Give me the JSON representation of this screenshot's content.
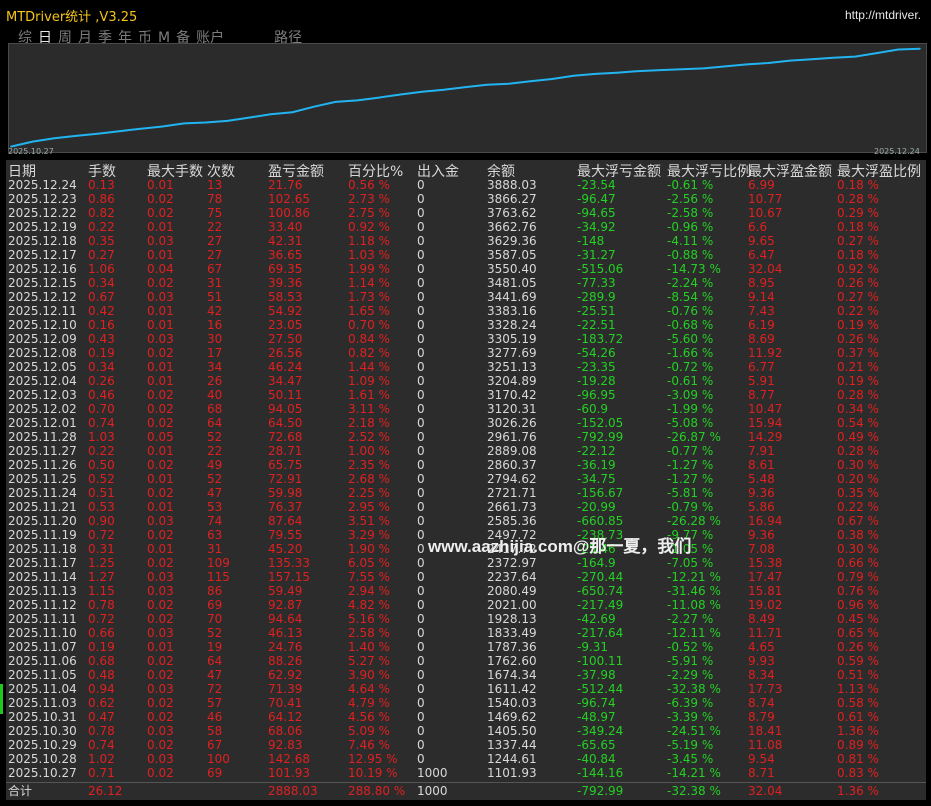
{
  "window": {
    "title": "MTDriver统计 ,V3.25",
    "url": "http://mtdriver."
  },
  "tabs": [
    {
      "label": "综",
      "active": false
    },
    {
      "label": "日",
      "active": true
    },
    {
      "label": "周",
      "active": false
    },
    {
      "label": "月",
      "active": false
    },
    {
      "label": "季",
      "active": false
    },
    {
      "label": "年",
      "active": false
    },
    {
      "label": "币",
      "active": false
    },
    {
      "label": "M",
      "active": false
    },
    {
      "label": "备",
      "active": false
    },
    {
      "label": "账户",
      "active": false
    }
  ],
  "route_tab": "路径",
  "chart": {
    "start_label": "2025.10.27",
    "end_label": "2025.12.24",
    "line_color": "#22b4f0",
    "type": "line"
  },
  "chart_data": {
    "type": "line",
    "x_start": "2025.10.27",
    "x_end": "2025.12.24",
    "x": [
      "2025.10.27",
      "2025.10.28",
      "2025.10.29",
      "2025.10.30",
      "2025.10.31",
      "2025.11.03",
      "2025.11.04",
      "2025.11.05",
      "2025.11.06",
      "2025.11.07",
      "2025.11.10",
      "2025.11.11",
      "2025.11.12",
      "2025.11.13",
      "2025.11.14",
      "2025.11.17",
      "2025.11.18",
      "2025.11.19",
      "2025.11.20",
      "2025.11.21",
      "2025.11.24",
      "2025.11.25",
      "2025.11.26",
      "2025.11.27",
      "2025.11.28",
      "2025.12.01",
      "2025.12.02",
      "2025.12.03",
      "2025.12.04",
      "2025.12.05",
      "2025.12.08",
      "2025.12.09",
      "2025.12.10",
      "2025.12.11",
      "2025.12.12",
      "2025.12.15",
      "2025.12.16",
      "2025.12.17",
      "2025.12.18",
      "2025.12.19",
      "2025.12.22",
      "2025.12.23",
      "2025.12.24"
    ],
    "series": [
      {
        "values": [
          1101.93,
          1244.61,
          1337.44,
          1405.5,
          1469.62,
          1540.03,
          1611.42,
          1674.34,
          1762.6,
          1787.36,
          1833.49,
          1928.13,
          2021.0,
          2080.49,
          2237.64,
          2372.97,
          2417.72,
          2497.72,
          2585.36,
          2661.73,
          2721.71,
          2794.62,
          2860.37,
          2889.08,
          2961.76,
          3026.26,
          3120.31,
          3170.42,
          3204.89,
          3251.13,
          3277.69,
          3305.19,
          3328.24,
          3383.16,
          3441.69,
          3481.05,
          3550.4,
          3587.05,
          3629.36,
          3662.76,
          3763.62,
          3866.27,
          3888.03
        ]
      }
    ]
  },
  "table": {
    "headers": [
      "日期",
      "手数",
      "最大手数",
      "次数",
      "盈亏金额",
      "百分比%",
      "出入金",
      "余额",
      "最大浮亏金额",
      "最大浮亏比例",
      "最大浮盈金额",
      "最大浮盈比例"
    ],
    "rows": [
      [
        "2025.12.24",
        "0.13",
        "0.01",
        "13",
        "21.76",
        "0.56 %",
        "0",
        "3888.03",
        "-23.54",
        "-0.61 %",
        "6.99",
        "0.18 %"
      ],
      [
        "2025.12.23",
        "0.86",
        "0.02",
        "78",
        "102.65",
        "2.73 %",
        "0",
        "3866.27",
        "-96.47",
        "-2.56 %",
        "10.77",
        "0.28 %"
      ],
      [
        "2025.12.22",
        "0.82",
        "0.02",
        "75",
        "100.86",
        "2.75 %",
        "0",
        "3763.62",
        "-94.65",
        "-2.58 %",
        "10.67",
        "0.29 %"
      ],
      [
        "2025.12.19",
        "0.22",
        "0.01",
        "22",
        "33.40",
        "0.92 %",
        "0",
        "3662.76",
        "-34.92",
        "-0.96 %",
        "6.6",
        "0.18 %"
      ],
      [
        "2025.12.18",
        "0.35",
        "0.03",
        "27",
        "42.31",
        "1.18 %",
        "0",
        "3629.36",
        "-148",
        "-4.11 %",
        "9.65",
        "0.27 %"
      ],
      [
        "2025.12.17",
        "0.27",
        "0.01",
        "27",
        "36.65",
        "1.03 %",
        "0",
        "3587.05",
        "-31.27",
        "-0.88 %",
        "6.47",
        "0.18 %"
      ],
      [
        "2025.12.16",
        "1.06",
        "0.04",
        "67",
        "69.35",
        "1.99 %",
        "0",
        "3550.40",
        "-515.06",
        "-14.73 %",
        "32.04",
        "0.92 %"
      ],
      [
        "2025.12.15",
        "0.34",
        "0.02",
        "31",
        "39.36",
        "1.14 %",
        "0",
        "3481.05",
        "-77.33",
        "-2.24 %",
        "8.95",
        "0.26 %"
      ],
      [
        "2025.12.12",
        "0.67",
        "0.03",
        "51",
        "58.53",
        "1.73 %",
        "0",
        "3441.69",
        "-289.9",
        "-8.54 %",
        "9.14",
        "0.27 %"
      ],
      [
        "2025.12.11",
        "0.42",
        "0.01",
        "42",
        "54.92",
        "1.65 %",
        "0",
        "3383.16",
        "-25.51",
        "-0.76 %",
        "7.43",
        "0.22 %"
      ],
      [
        "2025.12.10",
        "0.16",
        "0.01",
        "16",
        "23.05",
        "0.70 %",
        "0",
        "3328.24",
        "-22.51",
        "-0.68 %",
        "6.19",
        "0.19 %"
      ],
      [
        "2025.12.09",
        "0.43",
        "0.03",
        "30",
        "27.50",
        "0.84 %",
        "0",
        "3305.19",
        "-183.72",
        "-5.60 %",
        "8.69",
        "0.26 %"
      ],
      [
        "2025.12.08",
        "0.19",
        "0.02",
        "17",
        "26.56",
        "0.82 %",
        "0",
        "3277.69",
        "-54.26",
        "-1.66 %",
        "11.92",
        "0.37 %"
      ],
      [
        "2025.12.05",
        "0.34",
        "0.01",
        "34",
        "46.24",
        "1.44 %",
        "0",
        "3251.13",
        "-23.35",
        "-0.72 %",
        "6.77",
        "0.21 %"
      ],
      [
        "2025.12.04",
        "0.26",
        "0.01",
        "26",
        "34.47",
        "1.09 %",
        "0",
        "3204.89",
        "-19.28",
        "-0.61 %",
        "5.91",
        "0.19 %"
      ],
      [
        "2025.12.03",
        "0.46",
        "0.02",
        "40",
        "50.11",
        "1.61 %",
        "0",
        "3170.42",
        "-96.95",
        "-3.09 %",
        "8.77",
        "0.28 %"
      ],
      [
        "2025.12.02",
        "0.70",
        "0.02",
        "68",
        "94.05",
        "3.11 %",
        "0",
        "3120.31",
        "-60.9",
        "-1.99 %",
        "10.47",
        "0.34 %"
      ],
      [
        "2025.12.01",
        "0.74",
        "0.02",
        "64",
        "64.50",
        "2.18 %",
        "0",
        "3026.26",
        "-152.05",
        "-5.08 %",
        "15.94",
        "0.54 %"
      ],
      [
        "2025.11.28",
        "1.03",
        "0.05",
        "52",
        "72.68",
        "2.52 %",
        "0",
        "2961.76",
        "-792.99",
        "-26.87 %",
        "14.29",
        "0.49 %"
      ],
      [
        "2025.11.27",
        "0.22",
        "0.01",
        "22",
        "28.71",
        "1.00 %",
        "0",
        "2889.08",
        "-22.12",
        "-0.77 %",
        "7.91",
        "0.28 %"
      ],
      [
        "2025.11.26",
        "0.50",
        "0.02",
        "49",
        "65.75",
        "2.35 %",
        "0",
        "2860.37",
        "-36.19",
        "-1.27 %",
        "8.61",
        "0.30 %"
      ],
      [
        "2025.11.25",
        "0.52",
        "0.01",
        "52",
        "72.91",
        "2.68 %",
        "0",
        "2794.62",
        "-34.75",
        "-1.27 %",
        "5.48",
        "0.20 %"
      ],
      [
        "2025.11.24",
        "0.51",
        "0.02",
        "47",
        "59.98",
        "2.25 %",
        "0",
        "2721.71",
        "-156.67",
        "-5.81 %",
        "9.36",
        "0.35 %"
      ],
      [
        "2025.11.21",
        "0.53",
        "0.01",
        "53",
        "76.37",
        "2.95 %",
        "0",
        "2661.73",
        "-20.99",
        "-0.79 %",
        "5.86",
        "0.22 %"
      ],
      [
        "2025.11.20",
        "0.90",
        "0.03",
        "74",
        "87.64",
        "3.51 %",
        "0",
        "2585.36",
        "-660.85",
        "-26.28 %",
        "16.94",
        "0.67 %"
      ],
      [
        "2025.11.19",
        "0.72",
        "0.02",
        "63",
        "79.55",
        "3.29 %",
        "0",
        "2497.72",
        "-238.73",
        "-9.77 %",
        "9.36",
        "0.38 %"
      ],
      [
        "2025.11.18",
        "0.31",
        "0.01",
        "31",
        "45.20",
        "1.90 %",
        "0",
        "2417.72",
        "-25.46",
        "-1.05 %",
        "7.08",
        "0.30 %"
      ],
      [
        "2025.11.17",
        "1.25",
        "0.02",
        "109",
        "135.33",
        "6.05 %",
        "0",
        "2372.97",
        "-164.9",
        "-7.05 %",
        "15.38",
        "0.66 %"
      ],
      [
        "2025.11.14",
        "1.27",
        "0.03",
        "115",
        "157.15",
        "7.55 %",
        "0",
        "2237.64",
        "-270.44",
        "-12.21 %",
        "17.47",
        "0.79 %"
      ],
      [
        "2025.11.13",
        "1.15",
        "0.03",
        "86",
        "59.49",
        "2.94 %",
        "0",
        "2080.49",
        "-650.74",
        "-31.46 %",
        "15.81",
        "0.76 %"
      ],
      [
        "2025.11.12",
        "0.78",
        "0.02",
        "69",
        "92.87",
        "4.82 %",
        "0",
        "2021.00",
        "-217.49",
        "-11.08 %",
        "19.02",
        "0.96 %"
      ],
      [
        "2025.11.11",
        "0.72",
        "0.02",
        "70",
        "94.64",
        "5.16 %",
        "0",
        "1928.13",
        "-42.69",
        "-2.27 %",
        "8.49",
        "0.45 %"
      ],
      [
        "2025.11.10",
        "0.66",
        "0.03",
        "52",
        "46.13",
        "2.58 %",
        "0",
        "1833.49",
        "-217.64",
        "-12.11 %",
        "11.71",
        "0.65 %"
      ],
      [
        "2025.11.07",
        "0.19",
        "0.01",
        "19",
        "24.76",
        "1.40 %",
        "0",
        "1787.36",
        "-9.31",
        "-0.52 %",
        "4.65",
        "0.26 %"
      ],
      [
        "2025.11.06",
        "0.68",
        "0.02",
        "64",
        "88.26",
        "5.27 %",
        "0",
        "1762.60",
        "-100.11",
        "-5.91 %",
        "9.93",
        "0.59 %"
      ],
      [
        "2025.11.05",
        "0.48",
        "0.02",
        "47",
        "62.92",
        "3.90 %",
        "0",
        "1674.34",
        "-37.98",
        "-2.29 %",
        "8.34",
        "0.51 %"
      ],
      [
        "2025.11.04",
        "0.94",
        "0.03",
        "72",
        "71.39",
        "4.64 %",
        "0",
        "1611.42",
        "-512.44",
        "-32.38 %",
        "17.73",
        "1.13 %"
      ],
      [
        "2025.11.03",
        "0.62",
        "0.02",
        "57",
        "70.41",
        "4.79 %",
        "0",
        "1540.03",
        "-96.74",
        "-6.39 %",
        "8.74",
        "0.58 %"
      ],
      [
        "2025.10.31",
        "0.47",
        "0.02",
        "46",
        "64.12",
        "4.56 %",
        "0",
        "1469.62",
        "-48.97",
        "-3.39 %",
        "8.79",
        "0.61 %"
      ],
      [
        "2025.10.30",
        "0.78",
        "0.03",
        "58",
        "68.06",
        "5.09 %",
        "0",
        "1405.50",
        "-349.24",
        "-24.51 %",
        "18.41",
        "1.36 %"
      ],
      [
        "2025.10.29",
        "0.74",
        "0.02",
        "67",
        "92.83",
        "7.46 %",
        "0",
        "1337.44",
        "-65.65",
        "-5.19 %",
        "11.08",
        "0.89 %"
      ],
      [
        "2025.10.28",
        "1.02",
        "0.03",
        "100",
        "142.68",
        "12.95 %",
        "0",
        "1244.61",
        "-40.84",
        "-3.45 %",
        "9.54",
        "0.81 %"
      ],
      [
        "2025.10.27",
        "0.71",
        "0.02",
        "69",
        "101.93",
        "10.19 %",
        "1000",
        "1101.93",
        "-144.16",
        "-14.21 %",
        "8.71",
        "0.83 %"
      ]
    ],
    "summary": [
      "合计",
      "26.12",
      "",
      "",
      "2888.03",
      "288.80 %",
      "1000",
      "",
      "-792.99",
      "-32.38 %",
      "32.04",
      "1.36 %"
    ]
  },
  "watermark": "www.aazhijia.com@那一夏，我们",
  "colors": {
    "positive": "#e02020",
    "negative": "#24d024",
    "accent": "#f5c518",
    "line": "#22b4f0"
  }
}
